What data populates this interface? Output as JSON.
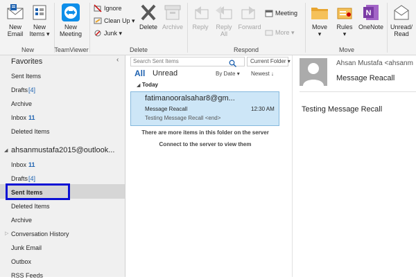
{
  "ribbon": {
    "new_group": {
      "new_email": [
        "New",
        "Email"
      ],
      "new_items": [
        "New",
        "Items"
      ],
      "label": "New"
    },
    "teamviewer": {
      "new_meeting": [
        "New",
        "Meeting"
      ],
      "label": "TeamViewer"
    },
    "delete_group": {
      "ignore": "Ignore",
      "clean_up": "Clean Up",
      "junk": "Junk",
      "delete": "Delete",
      "archive": "Archive",
      "label": "Delete"
    },
    "respond": {
      "reply": "Reply",
      "reply_all": [
        "Reply",
        "All"
      ],
      "forward": "Forward",
      "meeting": "Meeting",
      "more": "More",
      "label": "Respond"
    },
    "move_group": {
      "move": "Move",
      "rules": "Rules",
      "onenote": "OneNote",
      "unread_read": [
        "Unread/",
        "Read"
      ],
      "label": "Move"
    },
    "colors": {
      "accent": "#1e62b0",
      "onenote": "#7b3ba5",
      "folder": "#e8a530",
      "teamviewer": "#0e8ee9",
      "delete_x": "#595959"
    }
  },
  "folders": {
    "favorites_header": "Favorites",
    "favorites": [
      {
        "label": "Sent Items"
      },
      {
        "label": "Drafts",
        "count": "[4]"
      },
      {
        "label": "Archive"
      },
      {
        "label": "Inbox",
        "count": "11"
      },
      {
        "label": "Deleted Items"
      }
    ],
    "account": "ahsanmustafa2015@outlook...",
    "account_items": [
      {
        "label": "Inbox",
        "count": "11"
      },
      {
        "label": "Drafts",
        "count": "[4]"
      },
      {
        "label": "Sent Items",
        "selected": true
      },
      {
        "label": "Deleted Items"
      },
      {
        "label": "Archive"
      },
      {
        "label": "Conversation History"
      },
      {
        "label": "Junk Email"
      },
      {
        "label": "Outbox"
      },
      {
        "label": "RSS Feeds"
      }
    ],
    "highlight_color": "#0a10d4"
  },
  "list": {
    "search_placeholder": "Search Sent Items",
    "scope": "Current Folder",
    "tab_all": "All",
    "tab_unread": "Unread",
    "sort_by": "By Date",
    "sort_order": "Newest",
    "group_today": "Today",
    "message": {
      "from": "fatimanooralsahar8@gm...",
      "subject": "Message Reacall",
      "time": "12:30 AM",
      "preview": "Testing Message Recall <end>"
    },
    "more_items": "There are more items in this folder on the server",
    "connect": "Connect to the server to view them"
  },
  "reading": {
    "sender": "Ahsan Mustafa <ahsanm",
    "subject": "Message Reacall",
    "body": "Testing Message Recall"
  }
}
